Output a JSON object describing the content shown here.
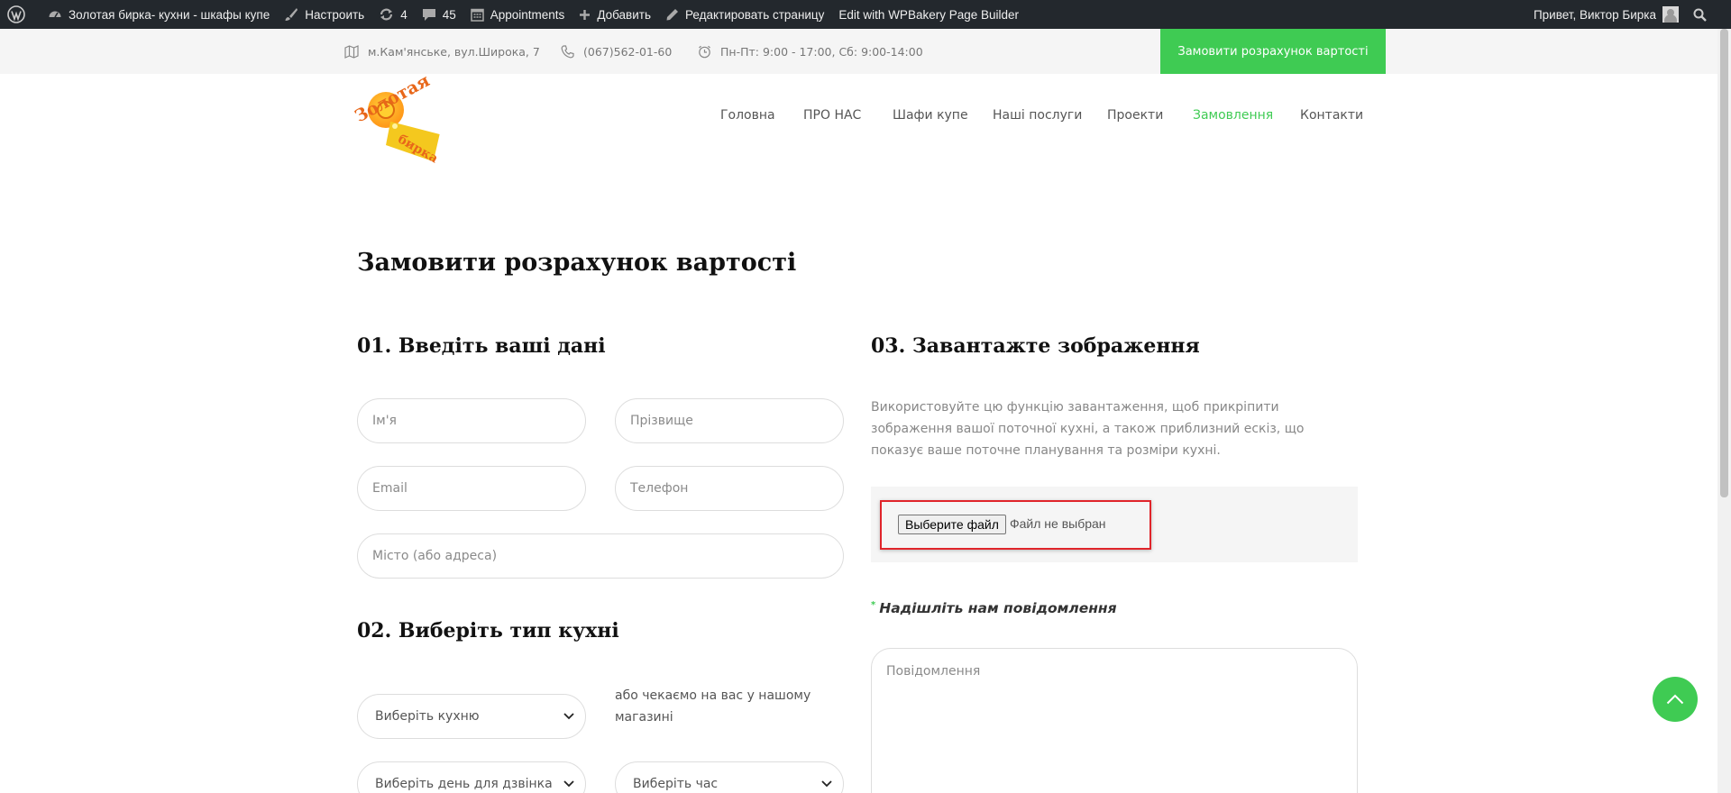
{
  "adminbar": {
    "site_name": "Золотая бирка- кухни - шкафы купе",
    "customize": "Настроить",
    "updates_count": "4",
    "comments_count": "45",
    "appointments": "Appointments",
    "add_new": "Добавить",
    "edit_page": "Редактировать страницу",
    "wpbakery": "Edit with WPBakery Page Builder",
    "greeting": "Привет, Виктор Бирка"
  },
  "topbar": {
    "address": "м.Кам'янське, вул.Широка, 7",
    "phone": "(067)562-01-60",
    "hours": "Пн-Пт: 9:00 - 17:00, Сб: 9:00-14:00",
    "cta": "Замовити розрахунок вартості"
  },
  "logo": {
    "line1": "Золотая",
    "line2": "бирка"
  },
  "nav": {
    "items": [
      {
        "label": "Головна"
      },
      {
        "label": "ПРО НАС"
      },
      {
        "label": "Шафи купе"
      },
      {
        "label": "Наші послуги"
      },
      {
        "label": "Проекти"
      },
      {
        "label": "Замовлення"
      },
      {
        "label": "Контакти"
      }
    ],
    "active": "Замовлення"
  },
  "page": {
    "title": "Замовити розрахунок вартості"
  },
  "section1": {
    "heading": "01. Введіть ваші дані",
    "first_name_placeholder": "Ім'я",
    "last_name_placeholder": "Прізвище",
    "email_placeholder": "Email",
    "phone_placeholder": "Телефон",
    "city_placeholder": "Місто (або адреса)"
  },
  "section2": {
    "heading": "02. Виберіть тип кухні",
    "kitchen_select": "Виберіть кухню",
    "store_note": "або чекаємо на вас у нашому магазині",
    "day_select": "Виберіть день для дзвінка",
    "time_select": "Виберіть час"
  },
  "section3": {
    "heading": "03. Завантажте зображення",
    "description": "Використовуйте цю функцію завантаження, щоб прикріпити зображення вашої поточної кухні, а також приблизний ескіз, що показує ваше поточне планування та розміри кухні.",
    "file_button": "Выберите файл",
    "file_status": "Файл не выбран",
    "message_label": "Надішліть нам повідомлення",
    "message_placeholder": "Повідомлення"
  },
  "colors": {
    "accent": "#3fcb53",
    "adminbar": "#23282d",
    "highlight": "#e0242a"
  }
}
